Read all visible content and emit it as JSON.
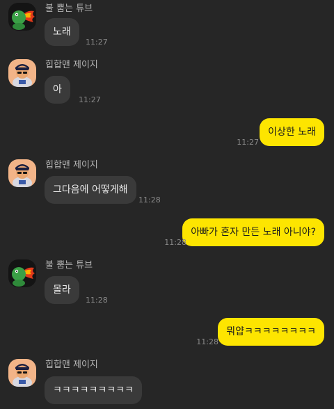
{
  "messages": [
    {
      "sender": "불 뿜는 튜브",
      "avatar": "tube-fire-avatar",
      "text": "노래",
      "time": "11:27"
    },
    {
      "sender": "힙합맨 제이지",
      "avatar": "hiphop-avatar",
      "text": "아",
      "time": "11:27"
    },
    {
      "text": "이상한 노래",
      "time": "11:27"
    },
    {
      "sender": "힙합맨 제이지",
      "avatar": "hiphop-avatar",
      "text": "그다음에 어떻게해",
      "time": "11:28"
    },
    {
      "text": "아빠가 혼자 만든 노래 아니야?",
      "time": "11:28"
    },
    {
      "sender": "불 뿜는 튜브",
      "avatar": "tube-fire-avatar",
      "text": "몰라",
      "time": "11:28"
    },
    {
      "text": "뭐얍ㅋㅋㅋㅋㅋㅋㅋㅋ",
      "time": "11:28"
    },
    {
      "sender": "힙합맨 제이지",
      "avatar": "hiphop-avatar",
      "text": "ㅋㅋㅋㅋㅋㅋㅋㅋㅋ",
      "time": ""
    }
  ],
  "colors": {
    "background": "#262626",
    "incoming_bubble": "#3a3a3a",
    "outgoing_bubble": "#fde500"
  }
}
